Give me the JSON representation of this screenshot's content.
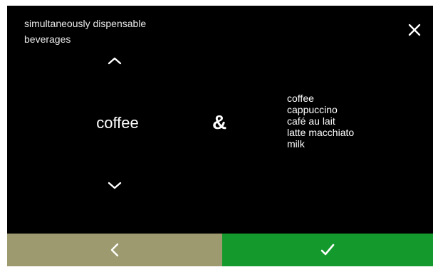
{
  "header": {
    "title_line1": "simultaneously dispensable",
    "title_line2": "beverages",
    "close_icon": "close-icon"
  },
  "selector": {
    "selected": "coffee",
    "up_icon": "chevron-up-icon",
    "down_icon": "chevron-down-icon"
  },
  "separator": "&",
  "compatible_beverages": [
    "coffee",
    "cappuccino",
    "café au lait",
    "latte macchiato",
    "milk"
  ],
  "footer": {
    "back_icon": "chevron-left-icon",
    "confirm_icon": "checkmark-icon",
    "back_color": "#9c9a6e",
    "confirm_color": "#149a2c"
  }
}
